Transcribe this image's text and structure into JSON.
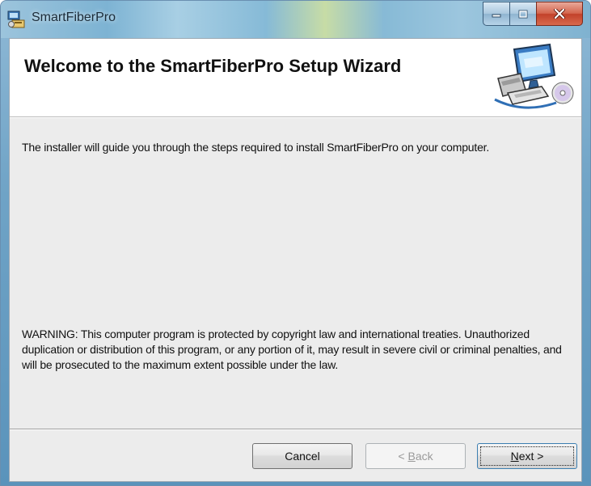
{
  "window": {
    "title": "SmartFiberPro"
  },
  "banner": {
    "title": "Welcome to the SmartFiberPro Setup Wizard",
    "image_icon": "computer-setup-icon"
  },
  "body": {
    "intro": "The installer will guide you through the steps required to install SmartFiberPro on your computer.",
    "warning": "WARNING: This computer program is protected by copyright law and international treaties. Unauthorized duplication or distribution of this program, or any portion of it, may result in severe civil or criminal penalties, and will be prosecuted to the maximum extent possible under the law."
  },
  "buttons": {
    "cancel": "Cancel",
    "back_prefix": "< ",
    "back_accel": "B",
    "back_rest": "ack",
    "next_accel": "N",
    "next_rest": "ext >"
  },
  "colors": {
    "titlebar": "#7db3d3",
    "client": "#ececec",
    "close_button": "#c2412a"
  }
}
